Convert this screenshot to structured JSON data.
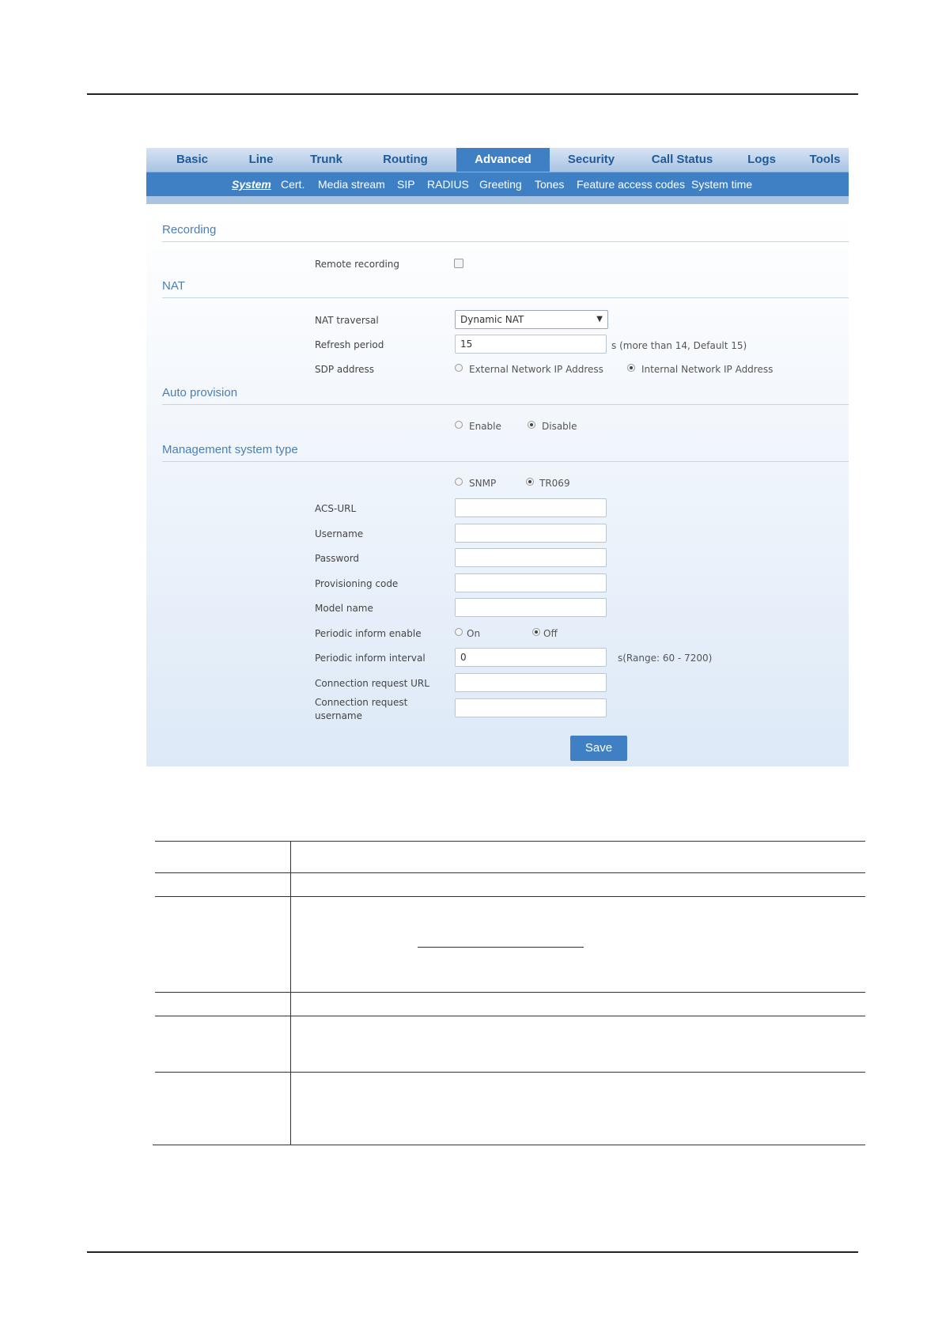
{
  "nav": {
    "tabs": [
      "Basic",
      "Line",
      "Trunk",
      "Routing",
      "Advanced",
      "Security",
      "Call Status",
      "Logs",
      "Tools"
    ],
    "active_tab": "Advanced",
    "subtabs": [
      "System",
      "Cert.",
      "Media stream",
      "SIP",
      "RADIUS",
      "Greeting",
      "Tones",
      "Feature access codes",
      "System time"
    ],
    "active_subtab": "System"
  },
  "recording": {
    "title": "Recording",
    "remote_label": "Remote recording"
  },
  "nat": {
    "title": "NAT",
    "traversal_label": "NAT traversal",
    "traversal_value": "Dynamic NAT",
    "refresh_label": "Refresh period",
    "refresh_value": "15",
    "refresh_hint": "s (more than 14, Default 15)",
    "sdp_label": "SDP address",
    "sdp_opt1": "External Network IP Address",
    "sdp_opt2": "Internal Network IP Address"
  },
  "auto": {
    "title": "Auto provision",
    "enable": "Enable",
    "disable": "Disable"
  },
  "mgmt": {
    "title": "Management system type",
    "snmp": "SNMP",
    "tr069": "TR069",
    "acs_url": "ACS-URL",
    "username": "Username",
    "password": "Password",
    "prov_code": "Provisioning code",
    "model_name": "Model name",
    "periodic_enable": "Periodic inform enable",
    "on": "On",
    "off": "Off",
    "periodic_interval": "Periodic inform interval",
    "interval_value": "0",
    "interval_hint": "s(Range: 60 - 7200)",
    "conn_url": "Connection request URL",
    "conn_user": "Connection request username"
  },
  "save_label": "Save"
}
